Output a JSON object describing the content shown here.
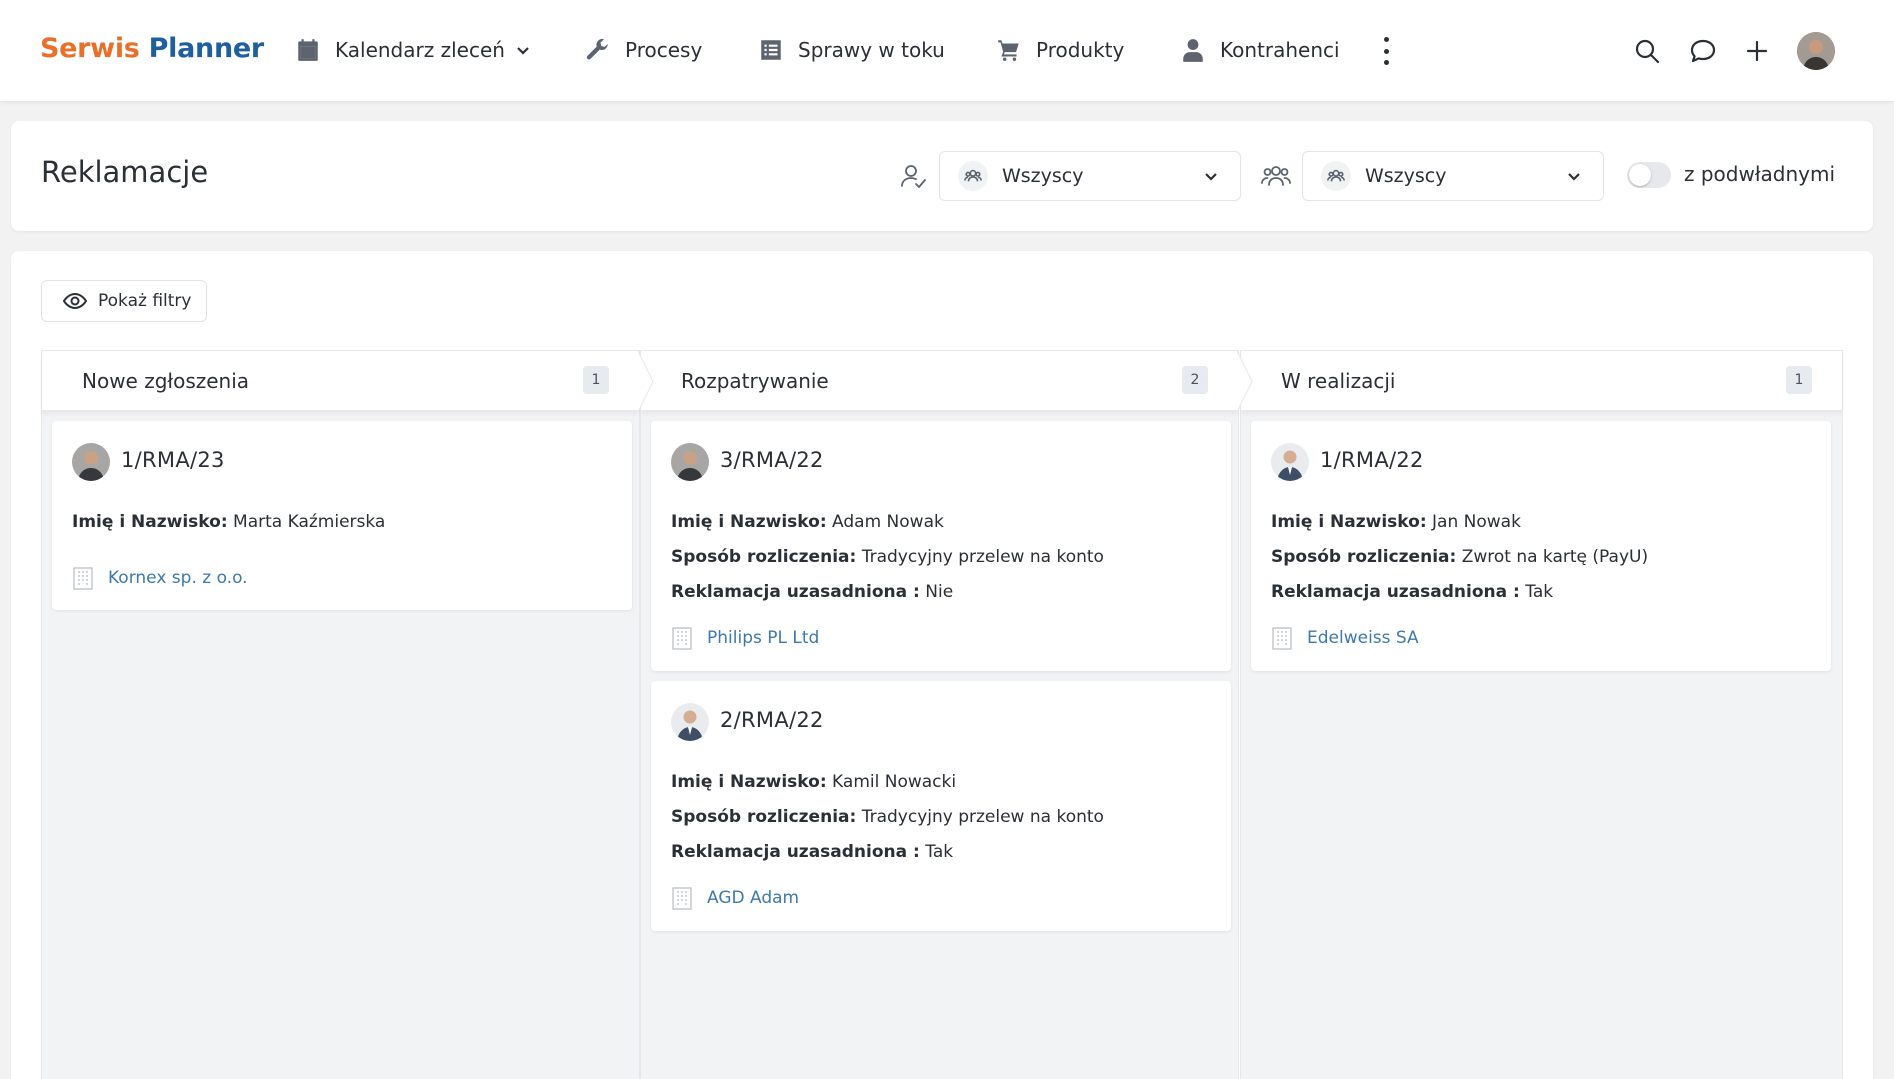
{
  "logo": {
    "part1": "Serwis",
    "part2": "Planner"
  },
  "nav": {
    "calendar": "Kalendarz zleceń",
    "processes": "Procesy",
    "cases": "Sprawy w toku",
    "products": "Produkty",
    "contractors": "Kontrahenci"
  },
  "header": {
    "title": "Reklamacje",
    "select1": "Wszyscy",
    "select2": "Wszyscy",
    "toggle_label": "z podwładnymi",
    "toggle_on": false
  },
  "board": {
    "filter_button": "Pokaż filtry",
    "columns": [
      {
        "title": "Nowe zgłoszenia",
        "count": "1",
        "cards": [
          {
            "number": "1/RMA/23",
            "name_label": "Imię i Nazwisko:",
            "name": "Marta Kaźmierska",
            "company": "Kornex sp. z o.o."
          }
        ]
      },
      {
        "title": "Rozpatrywanie",
        "count": "2",
        "cards": [
          {
            "number": "3/RMA/22",
            "name_label": "Imię i Nazwisko:",
            "name": "Adam Nowak",
            "payment_label": "Sposób rozliczenia:",
            "payment": "Tradycyjny przelew na konto",
            "justified_label": "Reklamacja uzasadniona :",
            "justified": "Nie",
            "company": "Philips PL Ltd"
          },
          {
            "number": "2/RMA/22",
            "name_label": "Imię i Nazwisko:",
            "name": "Kamil Nowacki",
            "payment_label": "Sposób rozliczenia:",
            "payment": "Tradycyjny przelew na konto",
            "justified_label": "Reklamacja uzasadniona :",
            "justified": "Tak",
            "company": "AGD Adam"
          }
        ]
      },
      {
        "title": "W realizacji",
        "count": "1",
        "cards": [
          {
            "number": "1/RMA/22",
            "name_label": "Imię i Nazwisko:",
            "name": "Jan Nowak",
            "payment_label": "Sposób rozliczenia:",
            "payment": "Zwrot na kartę (PayU)",
            "justified_label": "Reklamacja uzasadniona :",
            "justified": "Tak",
            "company": "Edelweiss SA"
          }
        ]
      }
    ]
  },
  "colors": {
    "logo_orange": "#e8702a",
    "logo_blue": "#1f5f9e",
    "link_blue": "#3d79ad",
    "board_bg": "#f2f3f5"
  },
  "icons": {
    "calendar": "calendar-icon",
    "processes": "wrench-icon",
    "cases": "list-icon",
    "products": "cart-icon",
    "contractors": "person-icon",
    "search": "search-icon",
    "chat": "chat-icon",
    "add": "plus-icon",
    "filter": "eye-icon",
    "company": "building-icon"
  }
}
